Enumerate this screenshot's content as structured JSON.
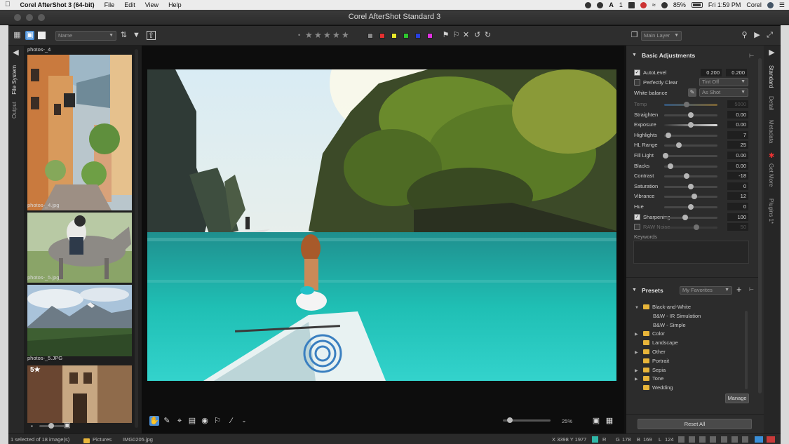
{
  "menubar": {
    "app_name": "Corel AfterShot 3 (64-bit)",
    "items": [
      "File",
      "Edit",
      "View",
      "Help"
    ],
    "battery": "85%",
    "clock": "Fri 1:59 PM",
    "user": "Corel",
    "badge_count": "1"
  },
  "window": {
    "title": "Corel AfterShot Standard 3"
  },
  "toolbar": {
    "sort_select": "Name",
    "rating_dot": "•",
    "stars": [
      "★",
      "★",
      "★",
      "★",
      "★"
    ],
    "color_labels": [
      "#888888",
      "#e53030",
      "#e8e82a",
      "#2ec62e",
      "#2840e0",
      "#e030e0"
    ],
    "layer_select": "Main Layer"
  },
  "left_tabs": {
    "file_system": "File System",
    "output": "Output"
  },
  "thumbnails": [
    {
      "caption": "photos-_4",
      "rating": ""
    },
    {
      "caption": "photos-_4.jpg",
      "rating": ""
    },
    {
      "caption": "photos-_5.jpg",
      "rating": ""
    },
    {
      "caption": "photos-_5.JPG",
      "rating": "5★"
    }
  ],
  "viewer": {
    "zoom": "25%"
  },
  "basic": {
    "title": "Basic Adjustments",
    "autolevel_label": "AutoLevel",
    "autolevel_v1": "0.200",
    "autolevel_v2": "0.200",
    "perfectly_clear_label": "Perfectly Clear",
    "perfectly_clear_select": "Tint Off",
    "wb_label": "White balance",
    "wb_select": "As Shot",
    "sliders": [
      {
        "label": "Temp",
        "value": "5000",
        "pos": 0.42,
        "dim": true
      },
      {
        "label": "Straighten",
        "value": "0.00",
        "pos": 0.5,
        "dim": false
      },
      {
        "label": "Exposure",
        "value": "0.00",
        "pos": 0.5,
        "dim": false
      },
      {
        "label": "Highlights",
        "value": "7",
        "pos": 0.08,
        "dim": false
      },
      {
        "label": "HL Range",
        "value": "25",
        "pos": 0.28,
        "dim": false
      },
      {
        "label": "Fill Light",
        "value": "0.00",
        "pos": 0.03,
        "dim": false
      },
      {
        "label": "Blacks",
        "value": "0.00",
        "pos": 0.12,
        "dim": false
      },
      {
        "label": "Contrast",
        "value": "-18",
        "pos": 0.42,
        "dim": false
      },
      {
        "label": "Saturation",
        "value": "0",
        "pos": 0.5,
        "dim": false
      },
      {
        "label": "Vibrance",
        "value": "12",
        "pos": 0.56,
        "dim": false
      },
      {
        "label": "Hue",
        "value": "0",
        "pos": 0.5,
        "dim": false
      },
      {
        "label": "Sharpening",
        "value": "100",
        "pos": 0.4,
        "dim": false
      },
      {
        "label": "RAW Noise",
        "value": "50",
        "pos": 0.6,
        "dim": true
      }
    ],
    "keywords_label": "Keywords"
  },
  "presets": {
    "title": "Presets",
    "favorites_select": "My Favorites",
    "items": [
      {
        "label": "Black-and-White",
        "level": 0,
        "open": true
      },
      {
        "label": "B&W - IR Simulation",
        "level": 1
      },
      {
        "label": "B&W - Simple",
        "level": 1
      },
      {
        "label": "Color",
        "level": 0
      },
      {
        "label": "Landscape",
        "level": 0,
        "leaf": true
      },
      {
        "label": "Other",
        "level": 0
      },
      {
        "label": "Portrait",
        "level": 0,
        "leaf": true
      },
      {
        "label": "Sepia",
        "level": 0
      },
      {
        "label": "Tone",
        "level": 0
      },
      {
        "label": "Wedding",
        "level": 0,
        "leaf": true
      }
    ],
    "manage_label": "Manage"
  },
  "reset_all_label": "Reset All",
  "right_tabs": [
    "Standard",
    "Detail",
    "Metadata",
    "Get More",
    "Plugins 1*"
  ],
  "status": {
    "selection": "1 selected of 18 image(s)",
    "folder": "Pictures",
    "file": "IMG0205.jpg",
    "coords": "X 3398  Y 1977",
    "r_label": "R",
    "g_label": "G",
    "g_value": "178",
    "b_label": "B",
    "b_value": "169",
    "l_label": "L",
    "l_value": "124"
  }
}
